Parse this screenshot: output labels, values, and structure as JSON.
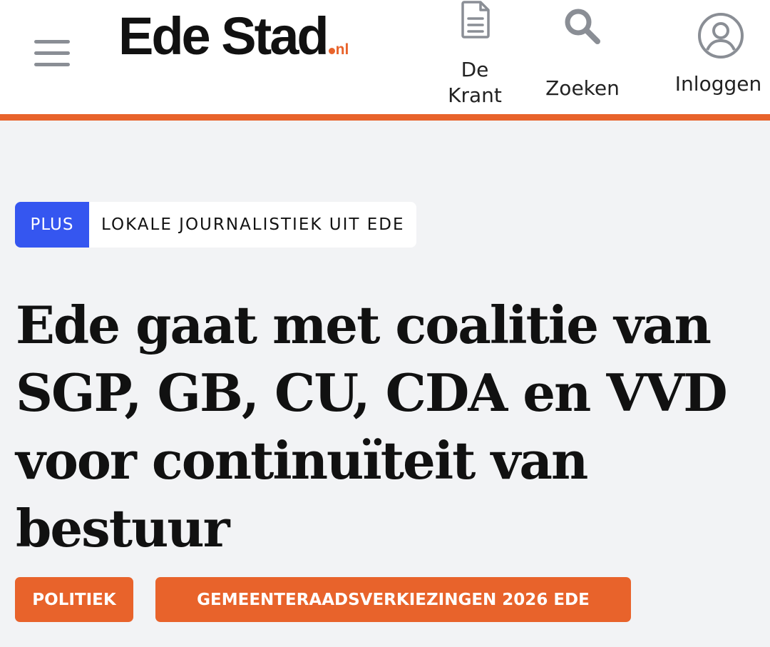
{
  "header": {
    "logo": {
      "name": "Ede Stad",
      "tld": "nl"
    },
    "nav": {
      "krant_label": "De Krant",
      "zoeken_label": "Zoeken",
      "login_label": "Inloggen"
    }
  },
  "article": {
    "plus_badge": "PLUS",
    "section_label": "LOKALE JOURNALISTIEK UIT EDE",
    "title": "Ede gaat met coalitie van SGP, GB, CU, CDA en VVD voor continuïteit van bestuur",
    "tags": [
      "POLITIEK",
      "GEMEENTERAADSVERKIEZINGEN 2026 EDE"
    ]
  },
  "colors": {
    "accent_orange": "#e8632b",
    "plus_blue": "#3556f0",
    "page_background": "#f2f3f5",
    "icon_grey": "#8a8e95"
  },
  "icons": {
    "menu": "menu-icon",
    "krant": "document-icon",
    "zoeken": "search-icon",
    "login": "user-icon"
  }
}
